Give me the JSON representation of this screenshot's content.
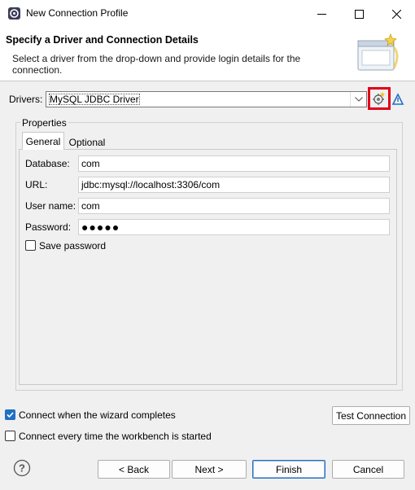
{
  "window": {
    "title": "New Connection Profile"
  },
  "header": {
    "title": "Specify a Driver and Connection Details",
    "description": "Select a driver from the drop-down and provide login details for the connection."
  },
  "drivers": {
    "label": "Drivers:",
    "selected": "MySQL JDBC Driver"
  },
  "properties": {
    "label": "Properties",
    "tabs": [
      {
        "label": "General"
      },
      {
        "label": "Optional"
      }
    ],
    "fields": {
      "database": {
        "label": "Database:",
        "value": "com"
      },
      "url": {
        "label": "URL:",
        "value": "jdbc:mysql://localhost:3306/com"
      },
      "username": {
        "label": "User name:",
        "value": "com"
      },
      "password": {
        "label": "Password:",
        "value": "●●●●●"
      }
    },
    "save_password": {
      "label": "Save password",
      "checked": false
    }
  },
  "options": {
    "connect_when_finish": {
      "label": "Connect when the wizard completes",
      "checked": true
    },
    "connect_on_startup": {
      "label": "Connect every time the workbench is started",
      "checked": false
    }
  },
  "buttons": {
    "test_connection": "Test Connection",
    "back": "< Back",
    "next": "Next >",
    "finish": "Finish",
    "cancel": "Cancel"
  },
  "colors": {
    "highlight": "#e0001b",
    "accent": "#1f6fc4"
  },
  "icons": [
    "app-icon",
    "minimize-icon",
    "maximize-icon",
    "close-icon",
    "wizard-banner-icon",
    "dropdown-chevron-icon",
    "new-driver-icon",
    "edit-driver-icon",
    "help-icon"
  ]
}
